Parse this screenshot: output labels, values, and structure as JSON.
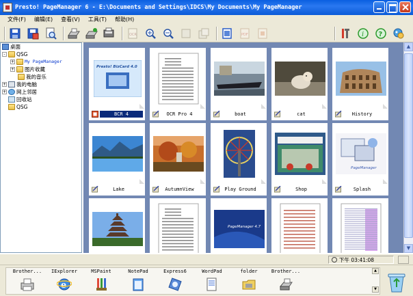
{
  "window": {
    "title": "Presto! PageManager 6 - E:\\Documents and Settings\\IDCS\\My Documents\\My PageManager"
  },
  "menu": [
    {
      "label": "文件(F)"
    },
    {
      "label": "编辑(E)"
    },
    {
      "label": "查看(V)"
    },
    {
      "label": "工具(T)"
    },
    {
      "label": "帮助(H)"
    }
  ],
  "toolbar": {
    "left_icons": [
      "save-icon",
      "save-as-icon",
      "zoom-view-icon",
      "scan-icon",
      "scan-select-icon",
      "send-to-icon",
      "ocr-icon",
      "zoom-in-icon",
      "zoom-out-icon",
      "fit-page-icon",
      "copy-icon",
      "print-icon",
      "pdf-icon",
      "export-icon"
    ],
    "right_icons": [
      "tools-icon",
      "info-icon",
      "help-icon",
      "assistant-icon"
    ]
  },
  "tree": [
    {
      "label": "桌面",
      "icon": "desktop-icon",
      "level": 0,
      "expander": ""
    },
    {
      "label": "QSG",
      "icon": "folder-icon",
      "level": 0,
      "expander": "-"
    },
    {
      "label": "My PageManager",
      "icon": "folder-icon",
      "level": 1,
      "expander": "+",
      "selected": true
    },
    {
      "label": "图片收藏",
      "icon": "folder-icon",
      "level": 1,
      "expander": "+"
    },
    {
      "label": "我的音乐",
      "icon": "folder-icon",
      "level": 1,
      "expander": ""
    },
    {
      "label": "我的电脑",
      "icon": "computer-icon",
      "level": 0,
      "expander": "+"
    },
    {
      "label": "网上邻居",
      "icon": "network-icon",
      "level": 0,
      "expander": "+"
    },
    {
      "label": "回收站",
      "icon": "recycle-bin-icon",
      "level": 0,
      "expander": ""
    },
    {
      "label": "QSG",
      "icon": "folder-icon",
      "level": 0,
      "expander": ""
    }
  ],
  "thumbnails": [
    {
      "name": "BCR 4",
      "selected": true,
      "kind": "bizcard",
      "text": "Presto! BizCard 4.0"
    },
    {
      "name": "OCR Pro 4",
      "selected": false,
      "kind": "doc"
    },
    {
      "name": "boat",
      "selected": false,
      "kind": "boat"
    },
    {
      "name": "cat",
      "selected": false,
      "kind": "cat"
    },
    {
      "name": "History",
      "selected": false,
      "kind": "history"
    },
    {
      "name": "Lake",
      "selected": false,
      "kind": "lake"
    },
    {
      "name": "AutumnView",
      "selected": false,
      "kind": "autumn"
    },
    {
      "name": "Play Ground",
      "selected": false,
      "kind": "wheel"
    },
    {
      "name": "Shop",
      "selected": false,
      "kind": "shop"
    },
    {
      "name": "Splash",
      "selected": false,
      "kind": "splash",
      "text": "PageManager"
    },
    {
      "name": "",
      "selected": false,
      "kind": "pagoda"
    },
    {
      "name": "",
      "selected": false,
      "kind": "doc"
    },
    {
      "name": "",
      "selected": false,
      "kind": "pm",
      "text": "PageManager 4.7"
    },
    {
      "name": "",
      "selected": false,
      "kind": "doc2"
    },
    {
      "name": "",
      "selected": false,
      "kind": "sheet"
    }
  ],
  "status": {
    "time": "下午 03:41:08"
  },
  "launcher": [
    {
      "label": "Brother...",
      "icon": "printer-icon"
    },
    {
      "label": "IExplorer",
      "icon": "internet-explorer-icon"
    },
    {
      "label": "MSPaint",
      "icon": "paint-icon"
    },
    {
      "label": "NotePad",
      "icon": "notepad-icon"
    },
    {
      "label": "Express6",
      "icon": "express-icon"
    },
    {
      "label": "WordPad",
      "icon": "wordpad-icon"
    },
    {
      "label": "folder",
      "icon": "folder-icon"
    },
    {
      "label": "Brother...",
      "icon": "fax-icon"
    }
  ],
  "colors": {
    "titlebar": "#0a5fe0",
    "panel": "#ece9d8",
    "thumb_bg": "#7288b3",
    "selected_caption": "#0a2a7a"
  }
}
